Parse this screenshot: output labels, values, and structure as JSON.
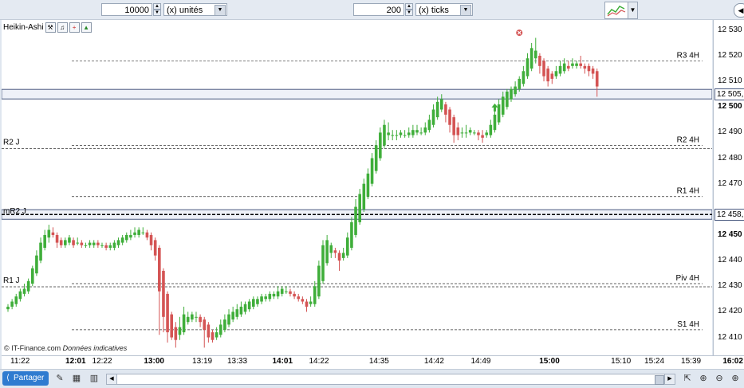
{
  "toolbar_top": {
    "quantity_value": "10000",
    "quantity_unit": "(x) unités",
    "ticks_value": "200",
    "ticks_unit": "(x) ticks"
  },
  "chart_title": "Heikin-Ashi",
  "credit": {
    "source": "© IT-Finance.com",
    "note": "Données indicatives"
  },
  "bottom_toolbar": {
    "share_label": "Partager"
  },
  "colors": {
    "up": "#3fae3a",
    "down": "#d45454",
    "level_line": "#333333",
    "price_box_border": "#4a5a80"
  },
  "chart_data": {
    "type": "candlestick",
    "style": "Heikin-Ashi",
    "ylim": [
      12403,
      12534
    ],
    "y_ticks": [
      {
        "label": "12 530",
        "value": 12530,
        "bold": false
      },
      {
        "label": "12 520",
        "value": 12520,
        "bold": false
      },
      {
        "label": "12 510",
        "value": 12510,
        "bold": false
      },
      {
        "label": "12 500",
        "value": 12500,
        "bold": true
      },
      {
        "label": "12 490",
        "value": 12490,
        "bold": false
      },
      {
        "label": "12 480",
        "value": 12480,
        "bold": false
      },
      {
        "label": "12 470",
        "value": 12470,
        "bold": false
      },
      {
        "label": "12 450",
        "value": 12450,
        "bold": true
      },
      {
        "label": "12 440",
        "value": 12440,
        "bold": false
      },
      {
        "label": "12 430",
        "value": 12430,
        "bold": false
      },
      {
        "label": "12 420",
        "value": 12420,
        "bold": false
      },
      {
        "label": "12 410",
        "value": 12410,
        "bold": false
      }
    ],
    "price_boxes": [
      {
        "label": "12 505,",
        "value": 12505
      },
      {
        "label": "12 458,",
        "value": 12458
      }
    ],
    "x_ticks": [
      {
        "label": "11:22",
        "x": 11,
        "bold": false
      },
      {
        "label": "12:01",
        "x": 44,
        "bold": true
      },
      {
        "label": "12:22",
        "x": 60,
        "bold": false
      },
      {
        "label": "13:00",
        "x": 91,
        "bold": true
      },
      {
        "label": "13:19",
        "x": 120,
        "bold": false
      },
      {
        "label": "13:33",
        "x": 141,
        "bold": false
      },
      {
        "label": "14:01",
        "x": 168,
        "bold": true
      },
      {
        "label": "14:22",
        "x": 190,
        "bold": false
      },
      {
        "label": "14:35",
        "x": 226,
        "bold": false
      },
      {
        "label": "14:42",
        "x": 259,
        "bold": false
      },
      {
        "label": "14:49",
        "x": 287,
        "bold": false
      },
      {
        "label": "15:00",
        "x": 328,
        "bold": true
      },
      {
        "label": "15:10",
        "x": 371,
        "bold": false
      },
      {
        "label": "15:24",
        "x": 391,
        "bold": false
      },
      {
        "label": "15:39",
        "x": 413,
        "bold": false
      },
      {
        "label": "16:02",
        "x": 438,
        "bold": true
      }
    ],
    "x_range": [
      0,
      445
    ],
    "levels": [
      {
        "label": "R3 4H",
        "value": 12518,
        "side": "right"
      },
      {
        "label": "R2 4H",
        "value": 12485,
        "side": "right"
      },
      {
        "label": "R1 4H",
        "value": 12465,
        "side": "right"
      },
      {
        "label": "Piv 4H",
        "value": 12431,
        "side": "right"
      },
      {
        "label": "S1 4H",
        "value": 12413,
        "side": "right"
      },
      {
        "label": "R2 J",
        "value": 12485,
        "side": "left"
      },
      {
        "label": "mR2 J",
        "value": 12458,
        "side": "left",
        "heavy": true
      },
      {
        "label": "R1 J",
        "value": 12431,
        "side": "left"
      }
    ],
    "candles": [
      [
        12421,
        12422,
        12420,
        12423
      ],
      [
        12422,
        12424,
        12421,
        12425
      ],
      [
        12423,
        12426,
        12422,
        12427
      ],
      [
        12425,
        12428,
        12424,
        12429
      ],
      [
        12427,
        12429,
        12426,
        12431
      ],
      [
        12428,
        12432,
        12427,
        12433
      ],
      [
        12431,
        12437,
        12430,
        12438
      ],
      [
        12435,
        12442,
        12434,
        12444
      ],
      [
        12440,
        12447,
        12439,
        12449
      ],
      [
        12445,
        12450,
        12444,
        12452
      ],
      [
        12449,
        12452,
        12447,
        12454
      ],
      [
        12451,
        12450,
        12449,
        12453
      ],
      [
        12450,
        12447,
        12445,
        12451
      ],
      [
        12448,
        12446,
        12445,
        12449
      ],
      [
        12446,
        12448,
        12445,
        12449
      ],
      [
        12447,
        12449,
        12446,
        12450
      ],
      [
        12448,
        12446,
        12445,
        12449
      ],
      [
        12447,
        12447,
        12446,
        12449
      ],
      [
        12447,
        12446,
        12445,
        12448
      ],
      [
        12446,
        12446,
        12445,
        12447
      ],
      [
        12446,
        12447,
        12445,
        12448
      ],
      [
        12446,
        12447,
        12445,
        12448
      ],
      [
        12447,
        12446,
        12445,
        12448
      ],
      [
        12446,
        12446,
        12445,
        12447
      ],
      [
        12446,
        12445,
        12444,
        12447
      ],
      [
        12445,
        12446,
        12444,
        12447
      ],
      [
        12445,
        12447,
        12444,
        12448
      ],
      [
        12446,
        12448,
        12445,
        12449
      ],
      [
        12447,
        12449,
        12446,
        12450
      ],
      [
        12448,
        12450,
        12447,
        12451
      ],
      [
        12449,
        12450,
        12448,
        12452
      ],
      [
        12450,
        12451,
        12449,
        12453
      ],
      [
        12450,
        12452,
        12449,
        12453
      ],
      [
        12451,
        12451,
        12450,
        12453
      ],
      [
        12451,
        12449,
        12448,
        12452
      ],
      [
        12450,
        12446,
        12444,
        12451
      ],
      [
        12448,
        12442,
        12440,
        12449
      ],
      [
        12445,
        12428,
        12411,
        12446
      ],
      [
        12436,
        12418,
        12412,
        12437
      ],
      [
        12427,
        12412,
        12408,
        12428
      ],
      [
        12419,
        12410,
        12409,
        12420
      ],
      [
        12414,
        12409,
        12406,
        12416
      ],
      [
        12411,
        12414,
        12409,
        12418
      ],
      [
        12412,
        12419,
        12411,
        12422
      ],
      [
        12416,
        12418,
        12415,
        12420
      ],
      [
        12417,
        12419,
        12416,
        12420
      ],
      [
        12418,
        12418,
        12416,
        12420
      ],
      [
        12418,
        12416,
        12414,
        12419
      ],
      [
        12417,
        12413,
        12406,
        12418
      ],
      [
        12415,
        12410,
        12408,
        12416
      ],
      [
        12412,
        12409,
        12408,
        12413
      ],
      [
        12410,
        12412,
        12409,
        12414
      ],
      [
        12411,
        12415,
        12410,
        12417
      ],
      [
        12413,
        12417,
        12412,
        12419
      ],
      [
        12415,
        12419,
        12414,
        12421
      ],
      [
        12417,
        12420,
        12416,
        12422
      ],
      [
        12418,
        12421,
        12417,
        12423
      ],
      [
        12419,
        12422,
        12418,
        12424
      ],
      [
        12420,
        12423,
        12419,
        12424
      ],
      [
        12421,
        12424,
        12420,
        12425
      ],
      [
        12422,
        12425,
        12421,
        12426
      ],
      [
        12423,
        12425,
        12422,
        12426
      ],
      [
        12424,
        12426,
        12423,
        12427
      ],
      [
        12425,
        12426,
        12424,
        12427
      ],
      [
        12425,
        12427,
        12424,
        12428
      ],
      [
        12426,
        12427,
        12425,
        12428
      ],
      [
        12426,
        12428,
        12425,
        12430
      ],
      [
        12427,
        12429,
        12426,
        12430
      ],
      [
        12428,
        12428,
        12427,
        12430
      ],
      [
        12428,
        12427,
        12426,
        12429
      ],
      [
        12427,
        12426,
        12425,
        12428
      ],
      [
        12426,
        12425,
        12424,
        12427
      ],
      [
        12425,
        12424,
        12423,
        12426
      ],
      [
        12424,
        12422,
        12420,
        12425
      ],
      [
        12423,
        12424,
        12422,
        12426
      ],
      [
        12423,
        12430,
        12422,
        12432
      ],
      [
        12426,
        12438,
        12425,
        12440
      ],
      [
        12432,
        12446,
        12431,
        12448
      ],
      [
        12439,
        12448,
        12438,
        12450
      ],
      [
        12443,
        12446,
        12441,
        12447
      ],
      [
        12444,
        12443,
        12441,
        12445
      ],
      [
        12443,
        12440,
        12436,
        12444
      ],
      [
        12441,
        12443,
        12440,
        12445
      ],
      [
        12442,
        12449,
        12441,
        12451
      ],
      [
        12445,
        12455,
        12444,
        12457
      ],
      [
        12450,
        12461,
        12449,
        12464
      ],
      [
        12455,
        12466,
        12454,
        12468
      ],
      [
        12460,
        12470,
        12459,
        12472
      ],
      [
        12465,
        12474,
        12464,
        12476
      ],
      [
        12470,
        12480,
        12469,
        12482
      ],
      [
        12475,
        12485,
        12474,
        12487
      ],
      [
        12480,
        12490,
        12479,
        12492
      ],
      [
        12485,
        12493,
        12484,
        12495
      ],
      [
        12489,
        12490,
        12487,
        12494
      ],
      [
        12489,
        12489,
        12487,
        12491
      ],
      [
        12489,
        12489,
        12487,
        12491
      ],
      [
        12489,
        12490,
        12488,
        12491
      ],
      [
        12489,
        12489,
        12488,
        12491
      ],
      [
        12489,
        12490,
        12488,
        12492
      ],
      [
        12489,
        12491,
        12488,
        12493
      ],
      [
        12490,
        12491,
        12489,
        12493
      ],
      [
        12490,
        12490,
        12489,
        12492
      ],
      [
        12490,
        12492,
        12489,
        12494
      ],
      [
        12491,
        12495,
        12490,
        12497
      ],
      [
        12493,
        12499,
        12492,
        12501
      ],
      [
        12496,
        12502,
        12495,
        12504
      ],
      [
        12499,
        12503,
        12498,
        12505
      ],
      [
        12501,
        12497,
        12494,
        12502
      ],
      [
        12499,
        12493,
        12490,
        12500
      ],
      [
        12496,
        12489,
        12486,
        12497
      ],
      [
        12492,
        12489,
        12487,
        12494
      ],
      [
        12490,
        12490,
        12488,
        12492
      ],
      [
        12490,
        12490,
        12488,
        12493
      ],
      [
        12490,
        12491,
        12489,
        12492
      ],
      [
        12490,
        12490,
        12489,
        12491
      ],
      [
        12490,
        12489,
        12487,
        12491
      ],
      [
        12489,
        12488,
        12486,
        12491
      ],
      [
        12489,
        12490,
        12488,
        12491
      ],
      [
        12489,
        12493,
        12488,
        12495
      ],
      [
        12491,
        12497,
        12490,
        12499
      ],
      [
        12494,
        12501,
        12493,
        12503
      ],
      [
        12497,
        12504,
        12496,
        12506
      ],
      [
        12500,
        12506,
        12499,
        12507
      ],
      [
        12503,
        12507,
        12502,
        12508
      ],
      [
        12505,
        12508,
        12504,
        12510
      ],
      [
        12507,
        12511,
        12506,
        12512
      ],
      [
        12509,
        12514,
        12508,
        12516
      ],
      [
        12512,
        12519,
        12511,
        12521
      ],
      [
        12515,
        12523,
        12514,
        12525
      ],
      [
        12519,
        12522,
        12517,
        12527
      ],
      [
        12520,
        12516,
        12513,
        12521
      ],
      [
        12518,
        12512,
        12510,
        12519
      ],
      [
        12515,
        12510,
        12508,
        12516
      ],
      [
        12513,
        12511,
        12509,
        12514
      ],
      [
        12512,
        12514,
        12511,
        12516
      ],
      [
        12513,
        12516,
        12512,
        12518
      ],
      [
        12514,
        12517,
        12513,
        12519
      ],
      [
        12516,
        12515,
        12514,
        12518
      ],
      [
        12516,
        12517,
        12515,
        12519
      ],
      [
        12516,
        12517,
        12515,
        12518
      ],
      [
        12517,
        12516,
        12515,
        12520
      ],
      [
        12516,
        12515,
        12513,
        12517
      ],
      [
        12516,
        12514,
        12512,
        12517
      ],
      [
        12515,
        12513,
        12511,
        12516
      ],
      [
        12514,
        12508,
        12504,
        12515
      ]
    ],
    "markers": [
      {
        "type": "buy-arrow",
        "index": 119,
        "value": 12502
      },
      {
        "type": "sell-cross",
        "index": 125,
        "value": 12529
      }
    ]
  }
}
